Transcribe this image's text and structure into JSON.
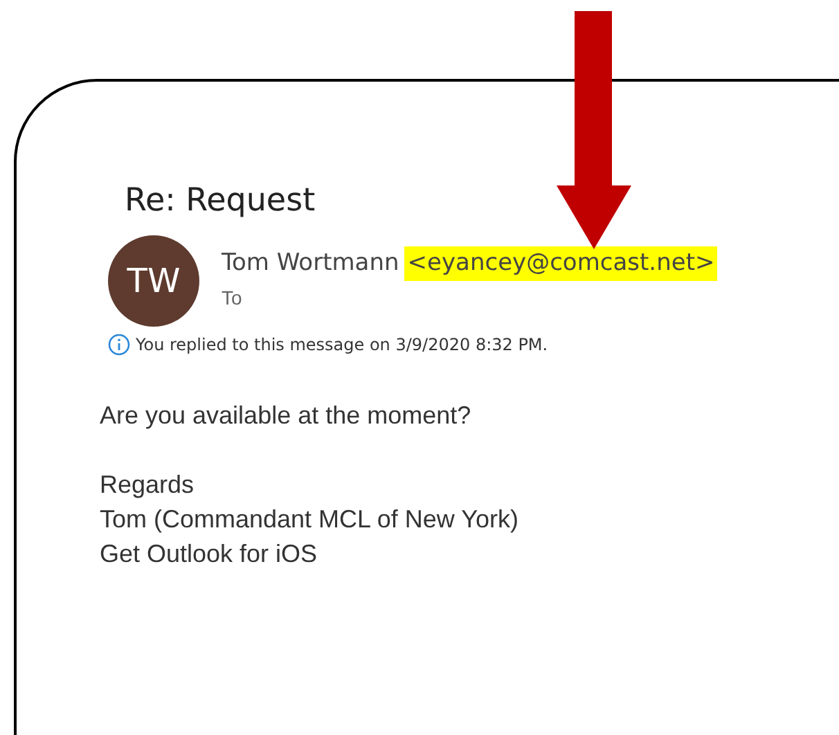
{
  "subject": "Re: Request",
  "sender": {
    "initials": "TW",
    "name": "Tom Wortmann",
    "address": "<eyancey@comcast.net>",
    "address_highlighted": true
  },
  "recipient_label": "To",
  "info_note": "You replied to this message on 3/9/2020 8:32 PM.",
  "body_paragraphs": [
    [
      "Are you available at the moment?"
    ],
    [
      "Regards",
      "Tom (Commandant MCL of New York)",
      "Get Outlook for iOS"
    ]
  ]
}
